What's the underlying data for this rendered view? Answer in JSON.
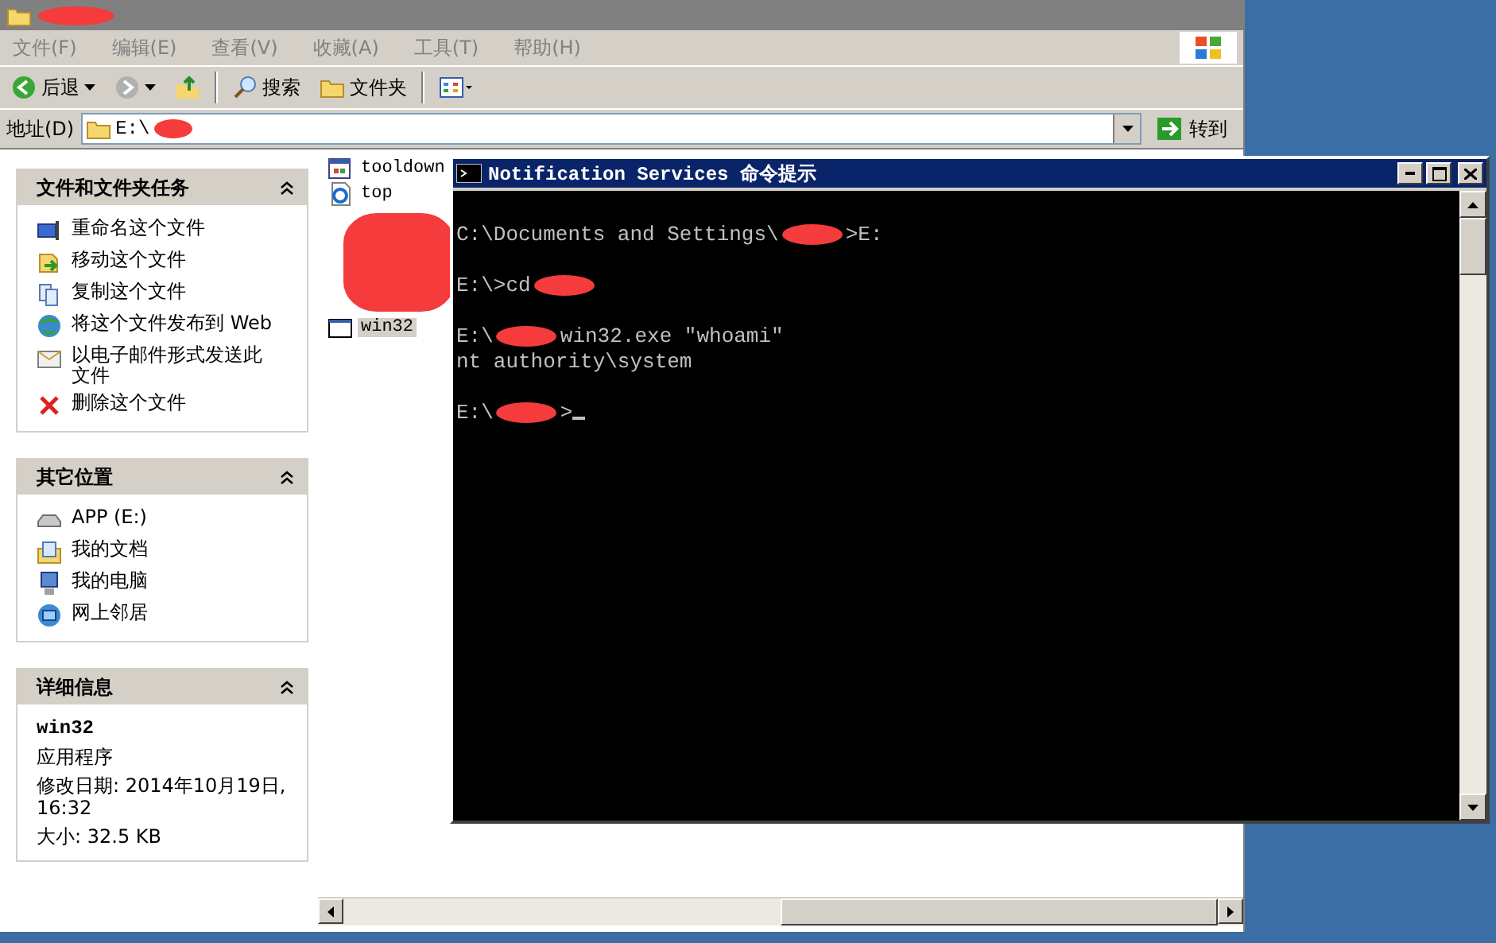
{
  "explorer": {
    "title": {
      "redacted": true
    },
    "menu": [
      "文件(F)",
      "编辑(E)",
      "查看(V)",
      "收藏(A)",
      "工具(T)",
      "帮助(H)"
    ],
    "toolbar": [
      {
        "kind": "back",
        "label": "后退"
      },
      {
        "kind": "forward"
      },
      {
        "kind": "up"
      },
      {
        "kind": "search",
        "label": "搜索"
      },
      {
        "kind": "folders",
        "label": "文件夹"
      },
      {
        "kind": "views"
      }
    ],
    "address": {
      "label": "地址(D)",
      "value": "E:\\",
      "redacted": true,
      "go": "转到"
    },
    "task_panels": [
      {
        "title": "文件和文件夹任务",
        "items": [
          {
            "kind": "link",
            "label": "重命名这个文件"
          },
          {
            "kind": "link",
            "label": "移动这个文件"
          },
          {
            "kind": "link",
            "label": "复制这个文件"
          },
          {
            "kind": "link",
            "label": "将这个文件发布到 Web"
          },
          {
            "kind": "link",
            "label": "以电子邮件形式发送此文件"
          },
          {
            "kind": "link",
            "label": "删除这个文件"
          }
        ]
      },
      {
        "title": "其它位置",
        "items": [
          {
            "kind": "link",
            "label": "APP (E:)"
          },
          {
            "kind": "link",
            "label": "我的文档"
          },
          {
            "kind": "link",
            "label": "我的电脑"
          },
          {
            "kind": "link",
            "label": "网上邻居"
          }
        ]
      },
      {
        "title": "详细信息",
        "items": [
          {
            "kind": "name",
            "label": "win32"
          },
          {
            "kind": "text",
            "label": "应用程序"
          },
          {
            "kind": "text",
            "label": "修改日期: 2014年10月19日, 16:32"
          },
          {
            "kind": "text",
            "label": "大小: 32.5 KB"
          }
        ]
      }
    ],
    "files": [
      {
        "kind": "file",
        "name": "tooldown",
        "selected": false
      },
      {
        "kind": "file",
        "name": "top",
        "selected": false
      },
      {
        "kind": "redacted"
      },
      {
        "kind": "file",
        "name": "win32",
        "selected": true
      }
    ]
  },
  "console": {
    "title": "Notification Services 命令提示",
    "lines": [
      {
        "kind": "line",
        "segments": [
          {
            "kind": "text",
            "text": "C:\\Documents and Settings\\"
          },
          {
            "kind": "redacted"
          },
          {
            "kind": "text",
            "text": ">E:"
          }
        ]
      },
      {
        "kind": "blank"
      },
      {
        "kind": "line",
        "segments": [
          {
            "kind": "text",
            "text": "E:\\>cd"
          },
          {
            "kind": "redacted"
          }
        ]
      },
      {
        "kind": "blank"
      },
      {
        "kind": "line",
        "segments": [
          {
            "kind": "text",
            "text": "E:\\"
          },
          {
            "kind": "redacted"
          },
          {
            "kind": "text",
            "text": "win32.exe \"whoami\""
          }
        ]
      },
      {
        "kind": "line",
        "segments": [
          {
            "kind": "text",
            "text": "nt authority\\system"
          }
        ]
      },
      {
        "kind": "blank"
      },
      {
        "kind": "line",
        "segments": [
          {
            "kind": "text",
            "text": "E:\\"
          },
          {
            "kind": "redacted"
          },
          {
            "kind": "text",
            "text": ">"
          },
          {
            "kind": "cursor"
          }
        ]
      }
    ]
  }
}
